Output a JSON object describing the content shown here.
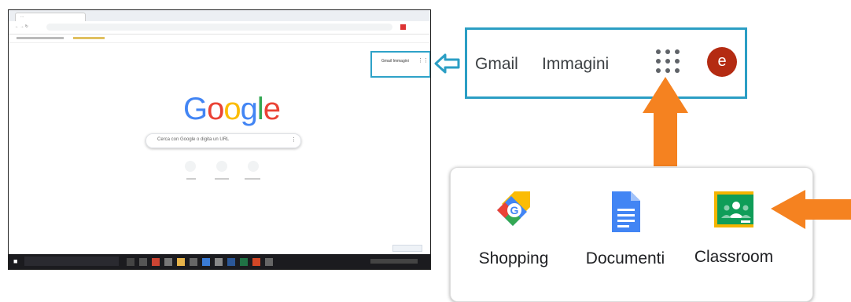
{
  "screenshot": {
    "tab_text": "...",
    "search_placeholder": "Cerca con Google o digita un URL",
    "google_logo": [
      "G",
      "o",
      "o",
      "g",
      "l",
      "e"
    ],
    "logo_colors": [
      "#4285f4",
      "#ea4335",
      "#fbbc05",
      "#4285f4",
      "#34a853",
      "#ea4335"
    ],
    "header_links": "Gmail  Immagini"
  },
  "zoom": {
    "gmail_label": "Gmail",
    "images_label": "Immagini",
    "avatar_letter": "e",
    "avatar_color": "#b42b12"
  },
  "apps": [
    {
      "label": "Shopping",
      "icon": "google-shopping-icon"
    },
    {
      "label": "Documenti",
      "icon": "google-docs-icon"
    },
    {
      "label": "Classroom",
      "icon": "google-classroom-icon"
    }
  ],
  "colors": {
    "highlight_blue": "#2b9ec4",
    "arrow_orange": "#f58220"
  }
}
